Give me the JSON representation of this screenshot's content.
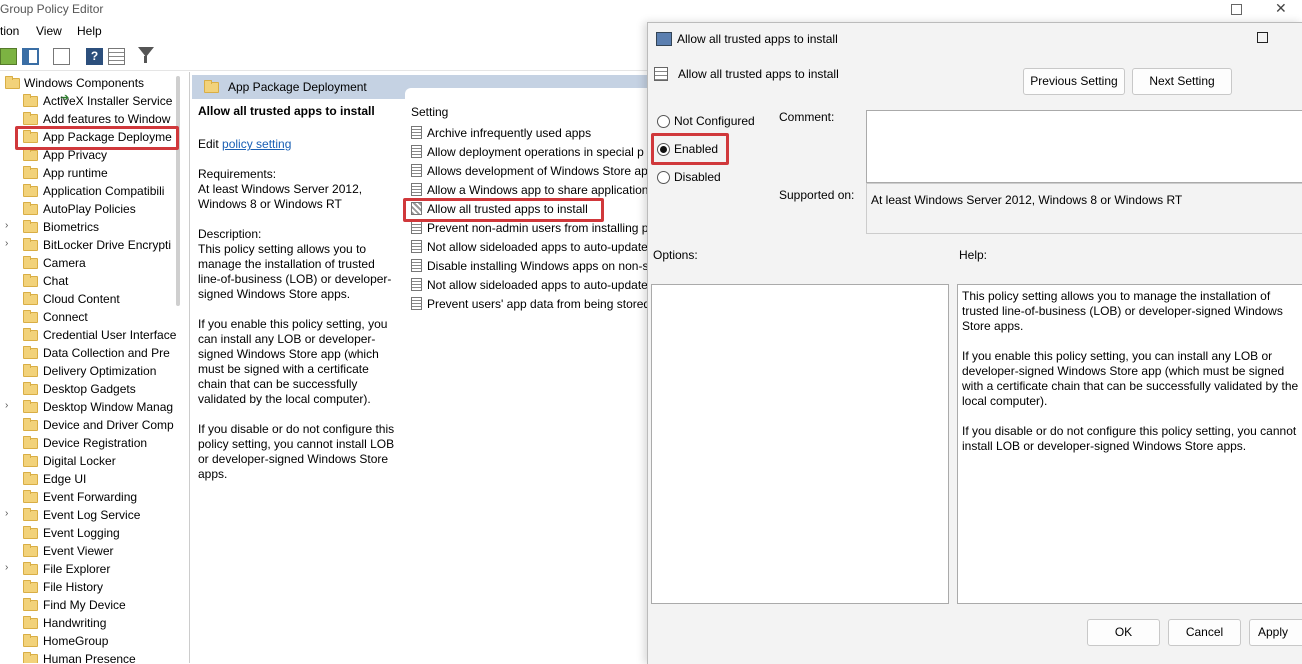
{
  "window": {
    "title": "Group Policy Editor"
  },
  "menu": [
    "tion",
    "View",
    "Help"
  ],
  "tree": {
    "root": "Windows Components",
    "items": [
      {
        "label": "ActiveX Installer Service",
        "expandable": false
      },
      {
        "label": "Add features to Window",
        "expandable": false
      },
      {
        "label": "App Package Deployme",
        "expandable": false,
        "selected": true
      },
      {
        "label": "App Privacy",
        "expandable": false
      },
      {
        "label": "App runtime",
        "expandable": false
      },
      {
        "label": "Application Compatibili",
        "expandable": false
      },
      {
        "label": "AutoPlay Policies",
        "expandable": false
      },
      {
        "label": "Biometrics",
        "expandable": true
      },
      {
        "label": "BitLocker Drive Encrypti",
        "expandable": true
      },
      {
        "label": "Camera",
        "expandable": false
      },
      {
        "label": "Chat",
        "expandable": false
      },
      {
        "label": "Cloud Content",
        "expandable": false
      },
      {
        "label": "Connect",
        "expandable": false
      },
      {
        "label": "Credential User Interface",
        "expandable": false
      },
      {
        "label": "Data Collection and Pre",
        "expandable": false
      },
      {
        "label": "Delivery Optimization",
        "expandable": false
      },
      {
        "label": "Desktop Gadgets",
        "expandable": false
      },
      {
        "label": "Desktop Window Manag",
        "expandable": true
      },
      {
        "label": "Device and Driver Comp",
        "expandable": false
      },
      {
        "label": "Device Registration",
        "expandable": false
      },
      {
        "label": "Digital Locker",
        "expandable": false
      },
      {
        "label": "Edge UI",
        "expandable": false
      },
      {
        "label": "Event Forwarding",
        "expandable": false
      },
      {
        "label": "Event Log Service",
        "expandable": true
      },
      {
        "label": "Event Logging",
        "expandable": false
      },
      {
        "label": "Event Viewer",
        "expandable": false
      },
      {
        "label": "File Explorer",
        "expandable": true
      },
      {
        "label": "File History",
        "expandable": false
      },
      {
        "label": "Find My Device",
        "expandable": false
      },
      {
        "label": "Handwriting",
        "expandable": false
      },
      {
        "label": "HomeGroup",
        "expandable": false
      },
      {
        "label": "Human Presence",
        "expandable": false
      }
    ]
  },
  "detail": {
    "header": "App Package Deployment",
    "policy_title": "Allow all trusted apps to install",
    "edit_prefix": "Edit",
    "edit_link": "policy setting",
    "requirements_label": "Requirements:",
    "requirements_text": "At least Windows Server 2012, Windows 8 or Windows RT",
    "description_label": "Description:",
    "desc_p1": "This policy setting allows you to manage the installation of trusted line-of-business (LOB) or developer-signed Windows Store apps.",
    "desc_p2": "If you enable this policy setting, you can install any LOB or developer-signed Windows Store app (which must be signed with a certificate chain that can be successfully validated by the local computer).",
    "desc_p3": "If you disable or do not configure this policy setting, you cannot install LOB or developer-signed Windows Store apps."
  },
  "settings": {
    "column_header": "Setting",
    "items": [
      "Archive infrequently used apps",
      "Allow deployment operations in special p",
      "Allows development of Windows Store ap",
      "Allow a Windows app to share application",
      "Allow all trusted apps to install",
      "Prevent non-admin users from installing p",
      "Not allow sideloaded apps to auto-update",
      "Disable installing Windows apps on non-s",
      "Not allow sideloaded apps to auto-update",
      "Prevent users' app data from being stored"
    ],
    "selected_index": 4
  },
  "dialog": {
    "title": "Allow all trusted apps to install",
    "policy_name": "Allow all trusted apps to install",
    "prev_button": "Previous Setting",
    "next_button": "Next Setting",
    "radio_not_configured": "Not Configured",
    "radio_enabled": "Enabled",
    "radio_disabled": "Disabled",
    "selected_option": "Enabled",
    "comment_label": "Comment:",
    "comment_value": "",
    "supported_label": "Supported on:",
    "supported_value": "At least Windows Server 2012, Windows 8 or Windows RT",
    "options_label": "Options:",
    "help_label": "Help:",
    "help_p1": "This policy setting allows you to manage the installation of trusted line-of-business (LOB) or developer-signed Windows Store apps.",
    "help_p2": "If you enable this policy setting, you can install any LOB or developer-signed Windows Store app (which must be signed with a certificate chain that can be successfully validated by the local computer).",
    "help_p3": "If you disable or do not configure this policy setting, you cannot install LOB or developer-signed Windows Store apps.",
    "ok_button": "OK",
    "cancel_button": "Cancel",
    "apply_button": "Apply"
  },
  "colors": {
    "highlight": "#d0383b",
    "header_band": "#c5d2e3",
    "link": "#1a5fb4",
    "folder": "#f2d27a"
  }
}
